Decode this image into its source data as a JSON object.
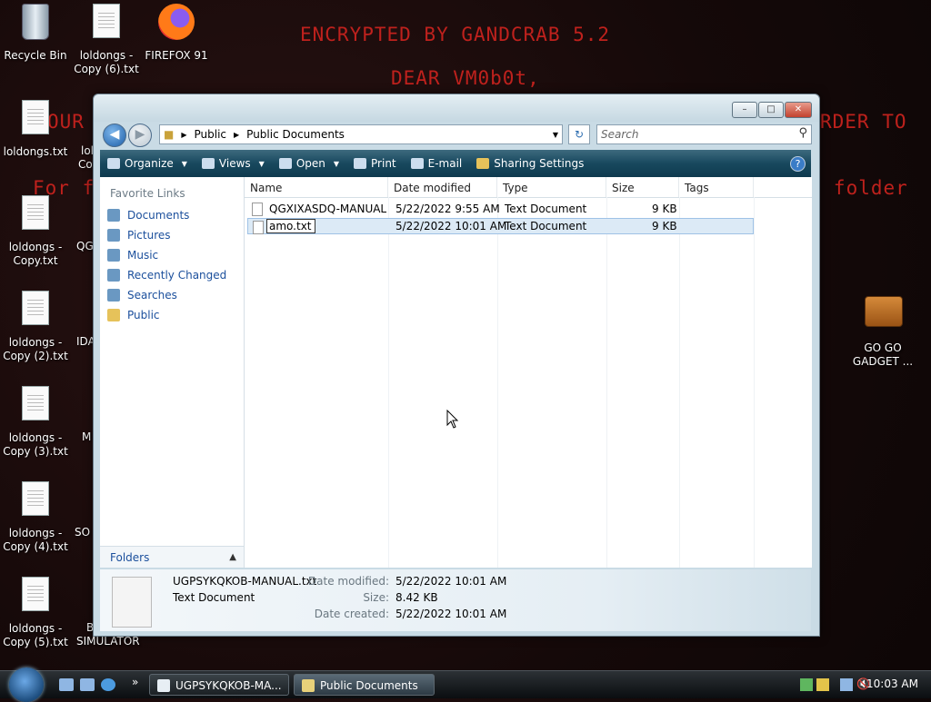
{
  "wallpaper": {
    "line1": "ENCRYPTED BY GANDCRAB 5.2",
    "line2": "DEAR VM0b0t,",
    "line3_left": "OUR",
    "line3_right": "RDER TO",
    "line4_left": "For fur",
    "line4_right": "ed folder"
  },
  "desktop_icons": [
    {
      "label": "Recycle Bin"
    },
    {
      "label": "loldongs - Copy (6).txt"
    },
    {
      "label": "FIREFOX 91"
    },
    {
      "label": "loldongs.txt"
    },
    {
      "label": "loldongs - Copy.txt"
    },
    {
      "label": "loldongs - Copy (2).txt"
    },
    {
      "label": "loldongs - Copy (3).txt"
    },
    {
      "label": "loldongs - Copy (4).txt"
    },
    {
      "label": "loldongs - Copy (5).txt"
    },
    {
      "label": "GO GO GADGET ..."
    }
  ],
  "partial_labels": [
    "lol",
    "Co",
    "QG",
    "IDA",
    "M",
    "SO",
    "B",
    "SIMULATOR"
  ],
  "window": {
    "breadcrumb": [
      "Public",
      "Public Documents"
    ],
    "search_placeholder": "Search",
    "toolbar": [
      "Organize",
      "Views",
      "Open",
      "Print",
      "E-mail",
      "Sharing Settings"
    ],
    "favorite_links_title": "Favorite Links",
    "favorite_links": [
      "Documents",
      "Pictures",
      "Music",
      "Recently Changed",
      "Searches",
      "Public"
    ],
    "folders_label": "Folders",
    "columns": [
      "Name",
      "Date modified",
      "Type",
      "Size",
      "Tags"
    ],
    "files": [
      {
        "name": "QGXIXASDQ-MANUAL...",
        "date": "5/22/2022 9:55 AM",
        "type": "Text Document",
        "size": "9 KB"
      },
      {
        "name": "amo.txt",
        "date": "5/22/2022 10:01 AM",
        "type": "Text Document",
        "size": "9 KB"
      }
    ],
    "details": {
      "filename": "UGPSYKQKOB-MANUAL.txt",
      "filetype": "Text Document",
      "date_modified_label": "Date modified:",
      "date_modified": "5/22/2022 10:01 AM",
      "size_label": "Size:",
      "size": "8.42 KB",
      "date_created_label": "Date created:",
      "date_created": "5/22/2022 10:01 AM"
    }
  },
  "taskbar": {
    "buttons": [
      "UGPSYKQKOB-MA...",
      "Public Documents"
    ],
    "clock": "10:03 AM"
  },
  "colors": {
    "ransom_text": "#c8231e",
    "toolbar": "#18485e",
    "selection": "#dceaf6"
  }
}
